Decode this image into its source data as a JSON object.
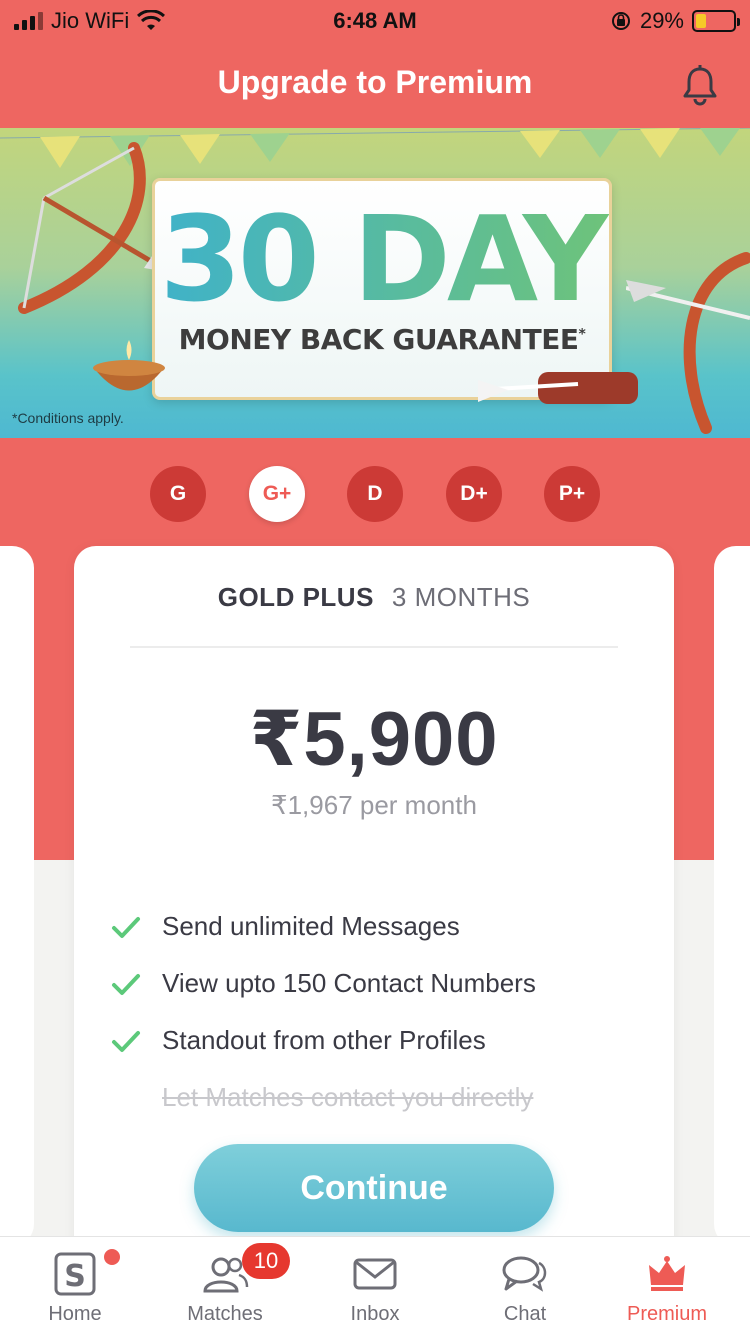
{
  "status_bar": {
    "carrier": "Jio WiFi",
    "time": "6:48 AM",
    "battery_percent": "29%",
    "battery_level": 0.29
  },
  "header": {
    "title": "Upgrade to Premium",
    "bell_icon": "bell-icon"
  },
  "banner": {
    "headline": "30 DAY",
    "subline": "MONEY BACK GUARANTEE",
    "asterisk": "*",
    "conditions": "*Conditions apply."
  },
  "plans": [
    {
      "label": "G",
      "active": false
    },
    {
      "label": "G+",
      "active": true
    },
    {
      "label": "D",
      "active": false
    },
    {
      "label": "D+",
      "active": false
    },
    {
      "label": "P+",
      "active": false
    }
  ],
  "card": {
    "plan_name": "GOLD PLUS",
    "duration": "3 MONTHS",
    "price": "₹5,900",
    "per_month": "₹1,967 per month",
    "features": [
      {
        "text": "Send unlimited Messages",
        "included": true
      },
      {
        "text": "View upto 150 Contact Numbers",
        "included": true
      },
      {
        "text": "Standout from other Profiles",
        "included": true
      },
      {
        "text": "Let Matches contact you directly",
        "included": false
      }
    ],
    "continue_label": "Continue"
  },
  "tabbar": {
    "tabs": [
      {
        "label": "Home",
        "icon": "home-icon",
        "dot": true
      },
      {
        "label": "Matches",
        "icon": "matches-icon",
        "badge": "10"
      },
      {
        "label": "Inbox",
        "icon": "inbox-icon"
      },
      {
        "label": "Chat",
        "icon": "chat-icon"
      },
      {
        "label": "Premium",
        "icon": "crown-icon",
        "active": true
      }
    ]
  },
  "colors": {
    "brand_red": "#ee6661",
    "accent_teal": "#58b8ce",
    "check_green": "#5cc97a",
    "active_tab": "#ee5b55"
  }
}
